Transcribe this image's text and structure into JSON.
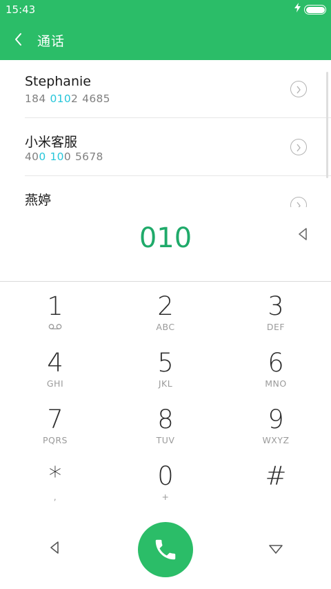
{
  "status_bar": {
    "time": "15:43",
    "charging_icon": "lightning-bolt-icon",
    "battery_icon": "battery-icon"
  },
  "app_bar": {
    "title": "通话",
    "back_icon": "chevron-left-icon"
  },
  "contacts": [
    {
      "name": "Stephanie",
      "number_parts": [
        {
          "text": "184",
          "hl": false
        },
        {
          "gap": true
        },
        {
          "text": "010",
          "hl": true
        },
        {
          "text": "2",
          "hl": false
        },
        {
          "gap": true
        },
        {
          "text": "4685",
          "hl": false
        }
      ]
    },
    {
      "name": "小米客服",
      "number_parts": [
        {
          "text": "40",
          "hl": false
        },
        {
          "text": "0",
          "hl": true
        },
        {
          "gap": true
        },
        {
          "text": "10",
          "hl": true
        },
        {
          "text": "0",
          "hl": false
        },
        {
          "gap": true
        },
        {
          "text": "5678",
          "hl": false
        }
      ]
    },
    {
      "name": "燕婷",
      "number_parts": []
    }
  ],
  "dial_input": {
    "value": "010",
    "backspace_icon": "backspace-triangle-icon"
  },
  "keypad": [
    {
      "num": "1",
      "sub": "",
      "icon": "voicemail-icon"
    },
    {
      "num": "2",
      "sub": "ABC"
    },
    {
      "num": "3",
      "sub": "DEF"
    },
    {
      "num": "4",
      "sub": "GHI"
    },
    {
      "num": "5",
      "sub": "JKL"
    },
    {
      "num": "6",
      "sub": "MNO"
    },
    {
      "num": "7",
      "sub": "PQRS"
    },
    {
      "num": "8",
      "sub": "TUV"
    },
    {
      "num": "9",
      "sub": "WXYZ"
    },
    {
      "num": "*",
      "sub": ","
    },
    {
      "num": "0",
      "sub": "+"
    },
    {
      "num": "#",
      "sub": ""
    }
  ],
  "bottom_bar": {
    "back_icon": "triangle-left-icon",
    "call_icon": "phone-handset-icon",
    "collapse_icon": "triangle-down-icon"
  },
  "colors": {
    "accent": "#2bbd68",
    "highlight": "#26c6da",
    "digits": "#1faa6a"
  }
}
